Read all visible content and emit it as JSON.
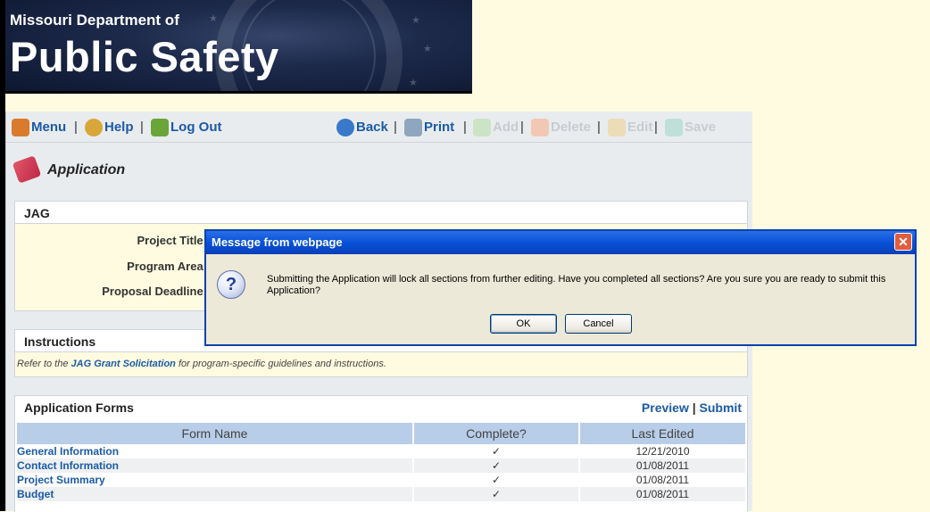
{
  "banner": {
    "department": "Missouri Department of",
    "title": "Public Safety"
  },
  "toolbar": {
    "menu": "Menu",
    "help": "Help",
    "logout": "Log Out",
    "back": "Back",
    "print": "Print",
    "add": "Add",
    "delete": "Delete",
    "edit": "Edit",
    "save": "Save",
    "sep": "|"
  },
  "page": {
    "heading": "Application"
  },
  "jag": {
    "heading": "JAG",
    "project_title_label": "Project Title:",
    "program_area_label": "Program Area:",
    "proposal_deadline_label": "Proposal Deadline:"
  },
  "instructions": {
    "heading": "Instructions",
    "text_before": "Refer to the ",
    "link": "JAG Grant Solicitation",
    "text_after": " for program-specific guidelines and instructions."
  },
  "forms": {
    "heading": "Application Forms",
    "preview": "Preview",
    "submit": "Submit",
    "columns": [
      "Form Name",
      "Complete?",
      "Last Edited"
    ],
    "rows": [
      {
        "name": "General Information",
        "complete": "✓",
        "edited": "12/21/2010"
      },
      {
        "name": "Contact Information",
        "complete": "✓",
        "edited": "01/08/2011"
      },
      {
        "name": "Project Summary",
        "complete": "✓",
        "edited": "01/08/2011"
      },
      {
        "name": "Budget",
        "complete": "✓",
        "edited": "01/08/2011"
      }
    ]
  },
  "dialog": {
    "title": "Message from webpage",
    "message": "Submitting the Application will lock all sections from further editing.  Have you completed all sections?  Are you sure you are ready to submit this Application?",
    "ok": "OK",
    "cancel": "Cancel",
    "close_glyph": "✕",
    "icon_glyph": "?"
  },
  "colors": {
    "link": "#1b5aa6",
    "background": "#fefbe0",
    "titlebar": "#0852d8"
  }
}
